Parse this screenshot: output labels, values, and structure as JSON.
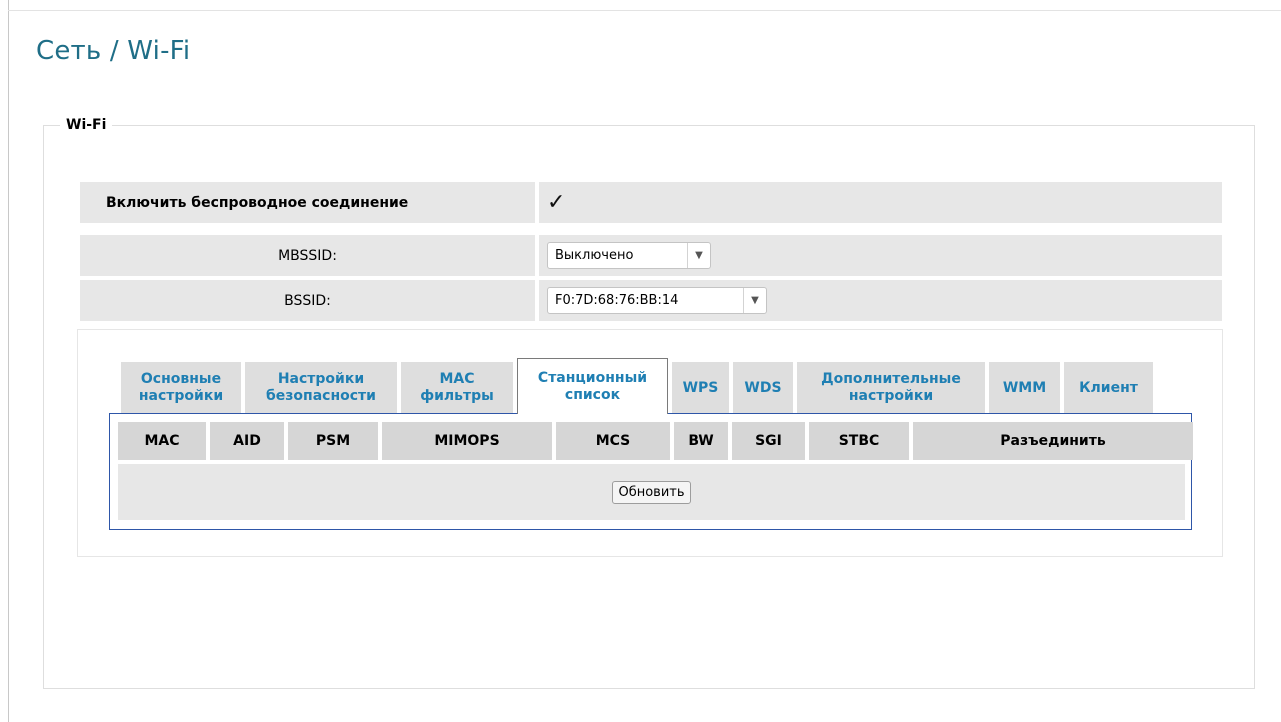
{
  "page": {
    "title": "Сеть /  Wi-Fi",
    "title_color": "#1f6e87",
    "accent_color": "#1f7fb3"
  },
  "wifi": {
    "legend": "Wi-Fi",
    "enable_label": "Включить беспроводное соединение",
    "enable_checked": true,
    "enable_check_glyph": "✓",
    "mbssid_label": "MBSSID:",
    "mbssid_value": "Выключено",
    "bssid_label": "BSSID:",
    "bssid_value": "F0:7D:68:76:BB:14"
  },
  "tabs": [
    {
      "line1": "Основные",
      "line2": "настройки",
      "active": false
    },
    {
      "line1": "Настройки",
      "line2": "безопасности",
      "active": false
    },
    {
      "line1": "MAC",
      "line2": "фильтры",
      "active": false
    },
    {
      "line1": "Станционный",
      "line2": "список",
      "active": true
    },
    {
      "line1": "WPS",
      "line2": "",
      "active": false
    },
    {
      "line1": "WDS",
      "line2": "",
      "active": false
    },
    {
      "line1": "Дополнительные",
      "line2": "настройки",
      "active": false
    },
    {
      "line1": "WMM",
      "line2": "",
      "active": false
    },
    {
      "line1": "Клиент",
      "line2": "",
      "active": false
    }
  ],
  "station_table": {
    "columns": [
      "MAC",
      "AID",
      "PSM",
      "MIMOPS",
      "MCS",
      "BW",
      "SGI",
      "STBC",
      "Разъединить"
    ],
    "refresh_label": "Обновить"
  }
}
